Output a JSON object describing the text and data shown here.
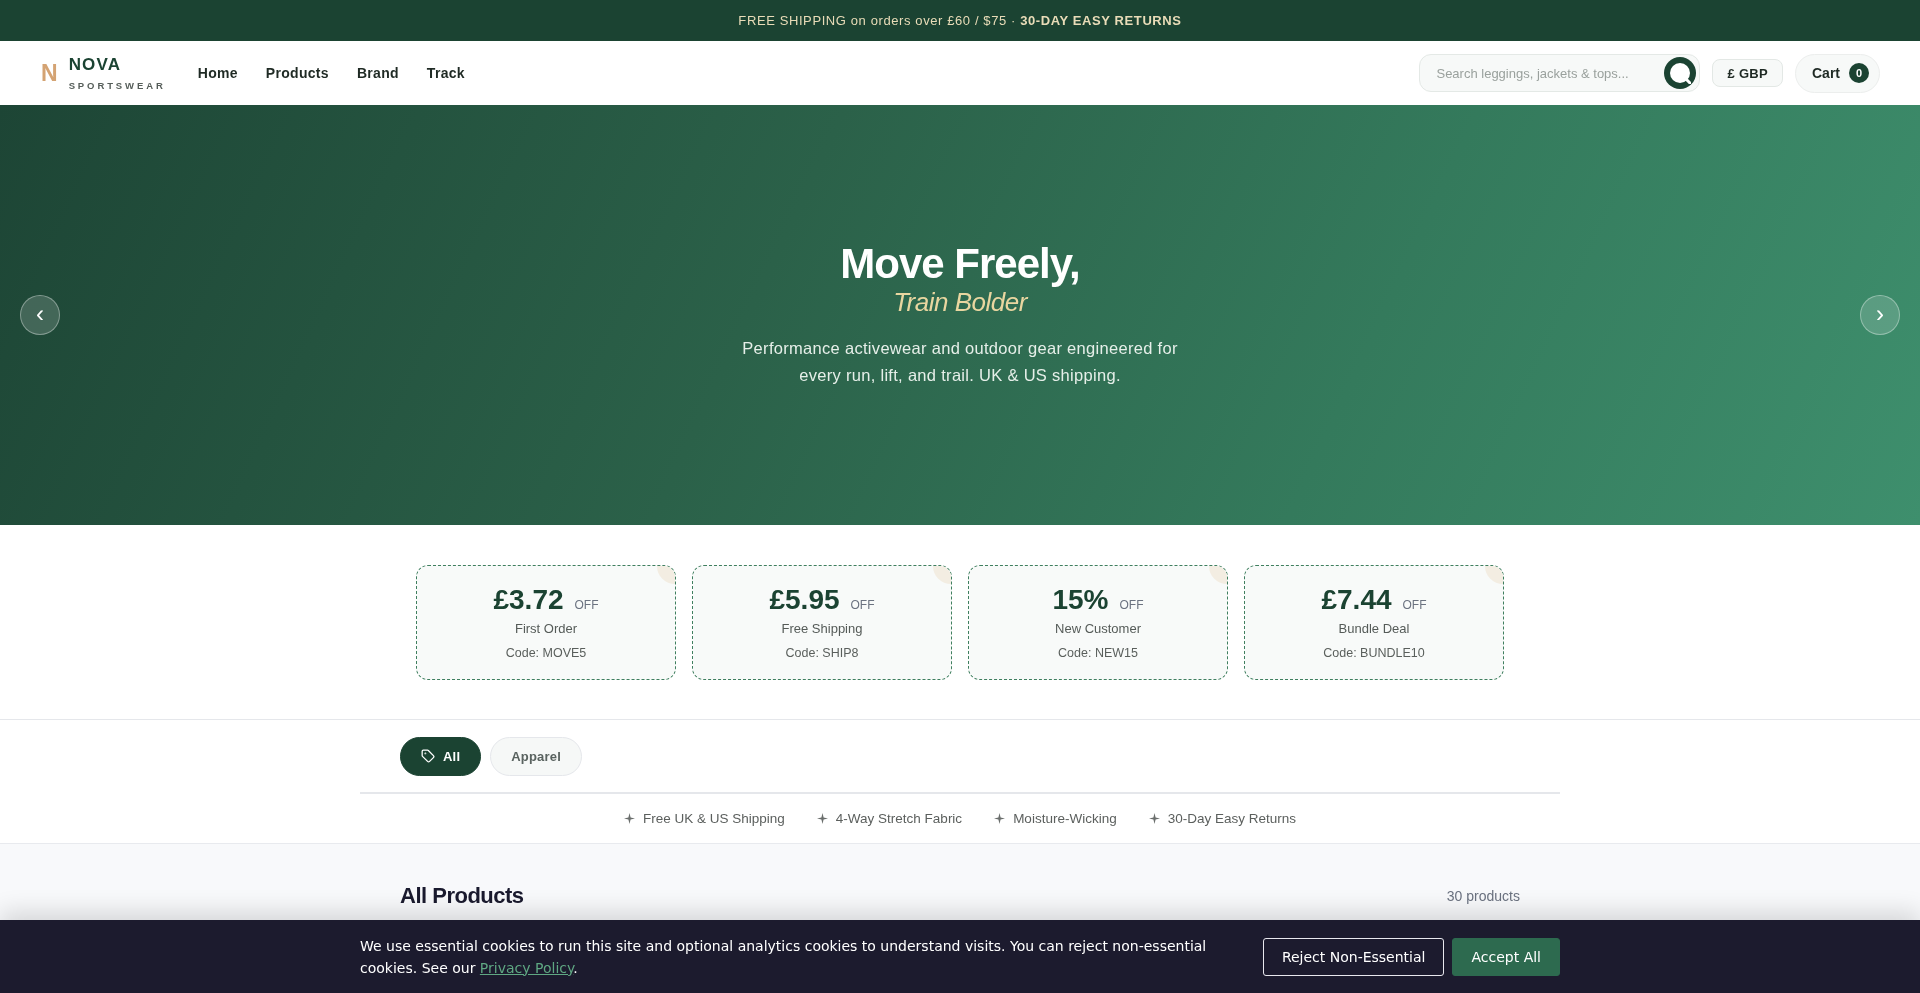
{
  "announcement_bar": {
    "text": "FREE SHIPPING on orders over £60 / $75 · **30-DAY EASY RETURNS**"
  },
  "header": {
    "logo": {
      "mark": "N",
      "name": "NOVA",
      "tagline": "SPORTSWEAR"
    },
    "nav": [
      "Home",
      "Products",
      "Brand",
      "Track"
    ],
    "search": {
      "placeholder": "Search leggings, jackets & tops..."
    },
    "currency": "£ GBP",
    "cart": {
      "label": "Cart",
      "count": "0"
    }
  },
  "hero": {
    "prev": "‹",
    "title": "Move Freely,",
    "subtitle": "Train Bolder",
    "description": "Performance activewear and outdoor gear engineered for every run, lift, and trail. UK & US shipping.",
    "next": "›"
  },
  "coupons": [
    {
      "amount": "£3.72",
      "suffix": "OFF",
      "label": "First Order",
      "code": "Code: MOVE5"
    },
    {
      "amount": "£5.95",
      "suffix": "OFF",
      "label": "Free Shipping",
      "code": "Code: SHIP8"
    },
    {
      "amount": "15%",
      "suffix": "OFF",
      "label": "New Customer",
      "code": "Code: NEW15"
    },
    {
      "amount": "£7.44",
      "suffix": "OFF",
      "label": "Bundle Deal",
      "code": "Code: BUNDLE10"
    }
  ],
  "filters": [
    {
      "label": "All",
      "kind": "all",
      "selected": true
    },
    {
      "label": "Apparel",
      "kind": "category",
      "selected": false
    }
  ],
  "features": [
    "Free UK & US Shipping",
    "4-Way Stretch Fabric",
    "Moisture-Wicking",
    "30-Day Easy Returns"
  ],
  "products": {
    "title": "All Products",
    "count": "30 products"
  },
  "cookie_banner": {
    "message": "We use essential cookies to run this site and optional analytics cookies to understand visits. You can reject non-essential cookies. See our ",
    "link": "Privacy Policy",
    "message_end": ".",
    "buttons": [
      {
        "label": "Reject Non-Essential",
        "kind": "outline"
      },
      {
        "label": "Accept All",
        "kind": "primary"
      }
    ]
  }
}
